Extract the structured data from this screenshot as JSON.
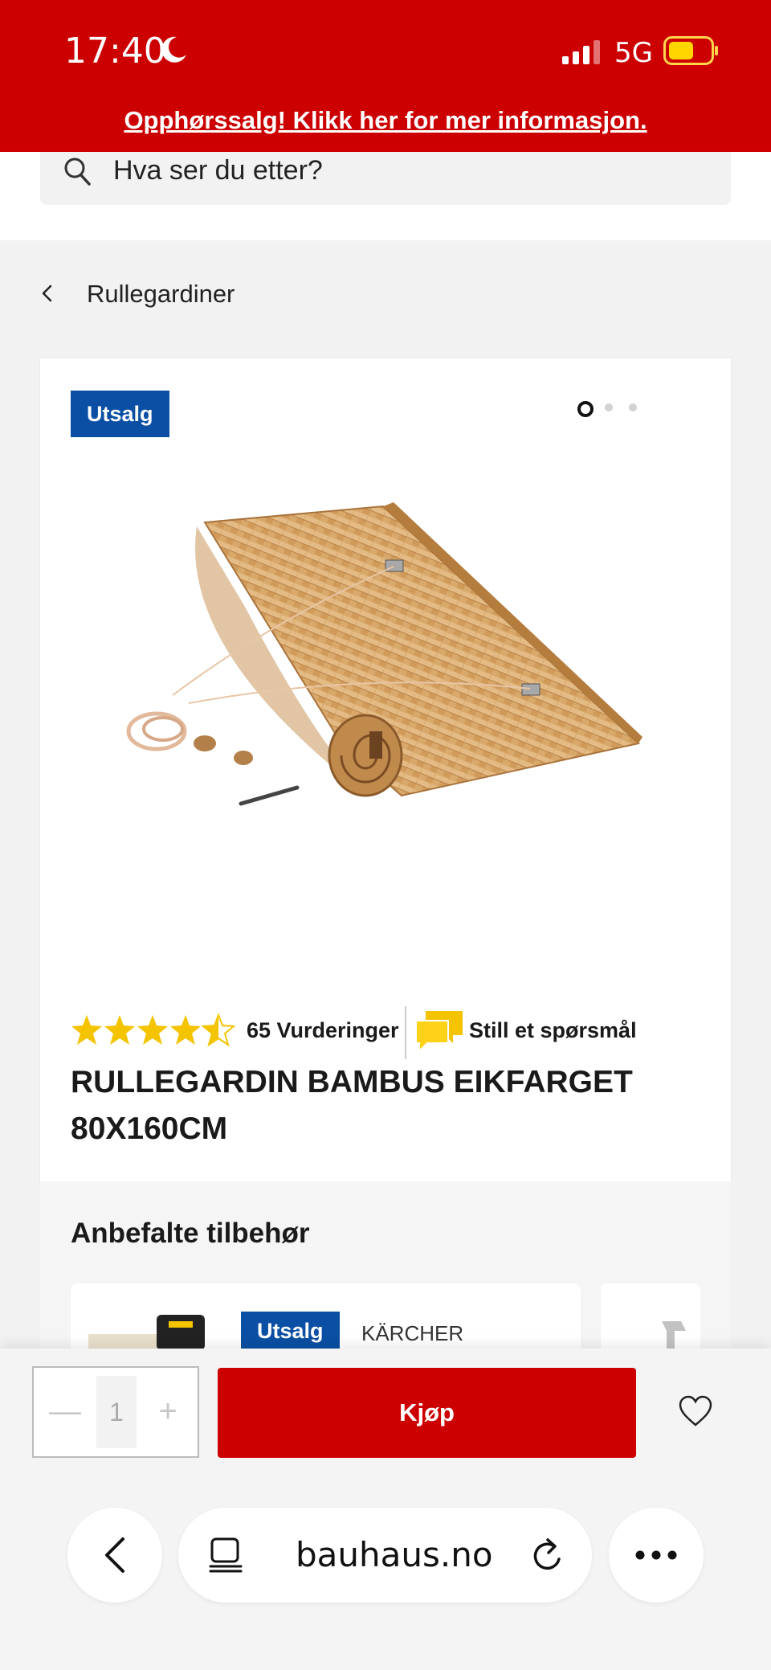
{
  "status_bar": {
    "time": "17:40",
    "network": "5G"
  },
  "banner": {
    "text": "Opphørssalg! Klikk her for mer informasjon."
  },
  "search": {
    "placeholder": "Hva ser du etter?"
  },
  "breadcrumb": {
    "label": "Rullegardiner"
  },
  "product": {
    "badge": "Utsalg",
    "carousel": {
      "total": 3,
      "active_index": 0
    },
    "rating": {
      "stars": 4.5,
      "max": 5,
      "count_label": "65 Vurderinger"
    },
    "question_label": "Still et spørsmål",
    "title_line1": "RULLEGARDIN BAMBUS EIKFARGET",
    "title_line2": "80X160CM"
  },
  "recommended": {
    "title": "Anbefalte tilbehør",
    "items": [
      {
        "badge": "Utsalg",
        "brand": "KÄRCHER"
      }
    ]
  },
  "buy_bar": {
    "quantity": "1",
    "minus": "—",
    "plus": "+",
    "buy_label": "Kjøp"
  },
  "browser": {
    "url": "bauhaus.no"
  },
  "colors": {
    "brand_red": "#cc0000",
    "sale_blue": "#0a4fa3",
    "star_yellow": "#f5c400"
  }
}
